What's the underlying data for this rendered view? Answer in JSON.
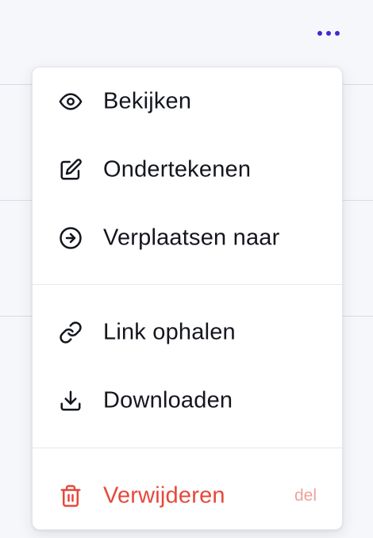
{
  "toolbar": {
    "more_icon": "more-horizontal-icon",
    "accent_color": "#3d2bd1"
  },
  "menu": {
    "items": [
      {
        "label": "Bekijken",
        "icon": "eye-icon"
      },
      {
        "label": "Ondertekenen",
        "icon": "edit-icon"
      },
      {
        "label": "Verplaatsen naar",
        "icon": "arrow-right-circle-icon"
      },
      {
        "label": "Link ophalen",
        "icon": "link-icon"
      },
      {
        "label": "Downloaden",
        "icon": "download-icon"
      },
      {
        "label": "Verwijderen",
        "icon": "trash-icon",
        "shortcut": "del",
        "color": "#e5483b"
      }
    ]
  }
}
